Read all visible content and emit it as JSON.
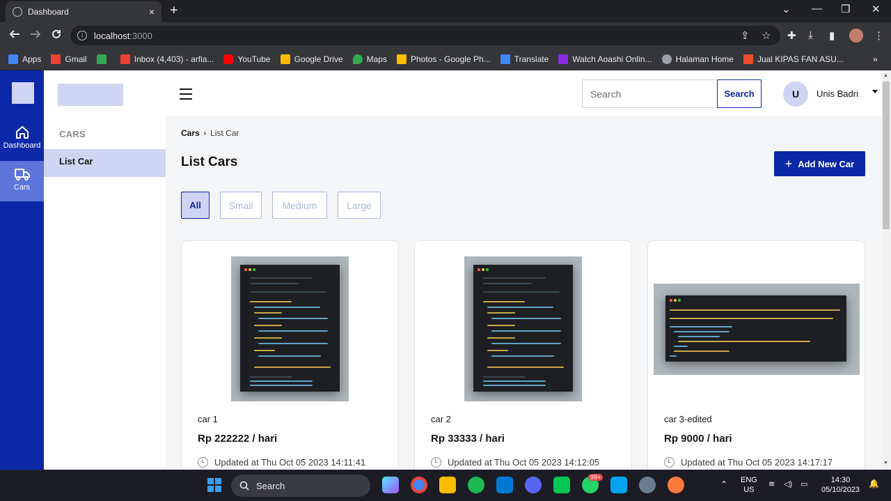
{
  "browser": {
    "tab_title": "Dashboard",
    "tab_close": "×",
    "new_tab": "+",
    "url_host": "localhost",
    "url_port": ":3000",
    "window_controls": [
      "⌄",
      "—",
      "❐",
      "✕"
    ],
    "nav_icons": [
      "arrow-back-icon",
      "arrow-forward-icon",
      "reload-icon"
    ],
    "bookmarks": [
      {
        "label": "Apps",
        "color": "#4285f4"
      },
      {
        "label": "Gmail",
        "color": "#ea4335"
      },
      {
        "label": "",
        "color": "#34a853"
      },
      {
        "label": "Inbox (4,403) - arfia...",
        "color": "#ea4335"
      },
      {
        "label": "YouTube",
        "color": "#ff0000"
      },
      {
        "label": "Google Drive",
        "color": "#fbbc04"
      },
      {
        "label": "Maps",
        "color": "#34a853"
      },
      {
        "label": "Photos - Google Ph...",
        "color": "#fbbc04"
      },
      {
        "label": "Translate",
        "color": "#4285f4"
      },
      {
        "label": "Watch Aoashi Onlin...",
        "color": "#8a2be2"
      },
      {
        "label": "Halaman Home",
        "color": "#9aa0a6"
      },
      {
        "label": "Jual KIPAS FAN ASU...",
        "color": "#ee4d2d"
      }
    ],
    "bookmarks_more": "»"
  },
  "rail": {
    "items": [
      {
        "label": "Dashboard",
        "icon": "home-icon"
      },
      {
        "label": "Cars",
        "icon": "truck-icon"
      }
    ]
  },
  "subnav": {
    "heading": "CARS",
    "items": [
      {
        "label": "List Car"
      }
    ]
  },
  "topbar": {
    "search_placeholder": "Search",
    "search_button": "Search",
    "user_initial": "U",
    "user_name": "Unis Badri"
  },
  "breadcrumb": {
    "root": "Cars",
    "separator": "›",
    "current": "List Car"
  },
  "page": {
    "title": "List Cars",
    "add_button": "Add New Car",
    "add_icon": "+",
    "filters": [
      {
        "label": "All",
        "active": true
      },
      {
        "label": "Small",
        "active": false
      },
      {
        "label": "Medium",
        "active": false
      },
      {
        "label": "Large",
        "active": false
      }
    ]
  },
  "cars": [
    {
      "name": "car 1",
      "price": "Rp 222222 / hari",
      "updated": "Updated at Thu Oct 05 2023 14:11:41"
    },
    {
      "name": "car 2",
      "price": "Rp 33333 / hari",
      "updated": "Updated at Thu Oct 05 2023 14:12:05"
    },
    {
      "name": "car 3-edited",
      "price": "Rp 9000 / hari",
      "updated": "Updated at Thu Oct 05 2023 14:17:17"
    }
  ],
  "taskbar": {
    "search_label": "Search",
    "notification_badge": "99+",
    "language_top": "ENG",
    "language_bottom": "US",
    "time": "14:30",
    "date": "05/10/2023"
  },
  "colors": {
    "primary": "#0d28a6",
    "primary_light": "#cfd4f1",
    "rail_active": "#5d75d9"
  }
}
